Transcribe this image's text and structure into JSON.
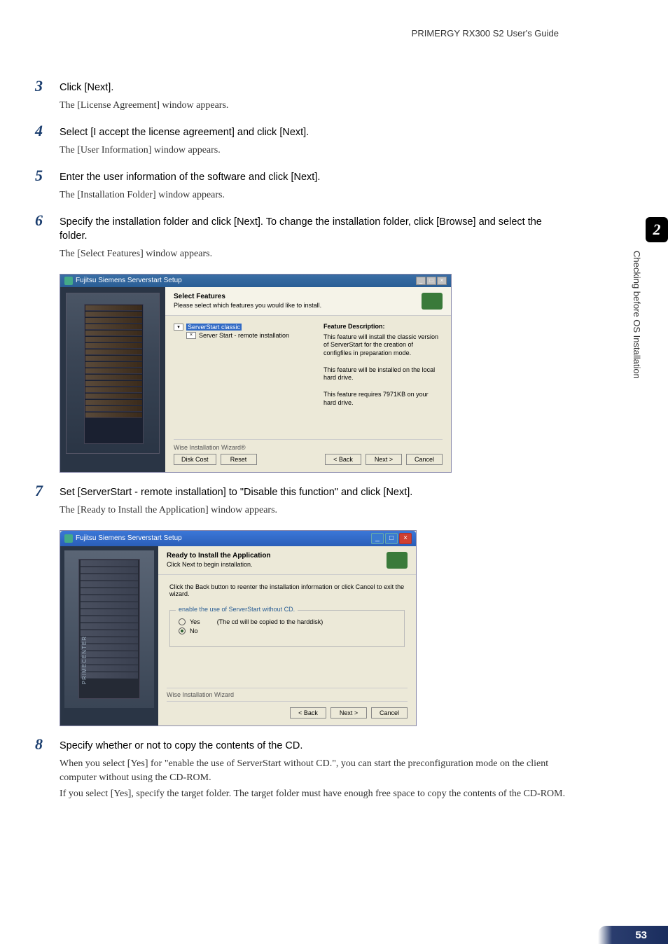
{
  "header": "PRIMERGY RX300 S2 User's Guide",
  "sideTab": {
    "chapter": "2",
    "label": "Checking before OS Installation"
  },
  "pageNumber": "53",
  "steps": {
    "s3": {
      "num": "3",
      "title": "Click [Next].",
      "desc": "The [License Agreement] window appears."
    },
    "s4": {
      "num": "4",
      "title": "Select [I accept the license agreement] and click [Next].",
      "desc": "The [User Information] window appears."
    },
    "s5": {
      "num": "5",
      "title": "Enter the user information of the software and click [Next].",
      "desc": "The [Installation Folder] window appears."
    },
    "s6": {
      "num": "6",
      "title": "Specify the installation folder and click [Next]. To change the installation folder, click [Browse] and select the folder.",
      "desc": "The [Select Features] window appears."
    },
    "s7": {
      "num": "7",
      "title": "Set [ServerStart - remote installation] to \"Disable this function\" and click [Next].",
      "desc": "The [Ready to Install the Application] window appears."
    },
    "s8": {
      "num": "8",
      "title": "Specify whether or not to copy the contents of the CD.",
      "desc1": "When you select [Yes] for \"enable the use of ServerStart without CD.\", you can start the preconfiguration mode on the client computer without using the CD-ROM.",
      "desc2": "If you select [Yes], specify the target folder. The target folder must have enough free space to copy the contents of the CD-ROM."
    }
  },
  "dialog1": {
    "title": "Fujitsu Siemens Serverstart Setup",
    "headerTitle": "Select Features",
    "headerSub": "Please select which features you would like to install.",
    "tree": {
      "item1": "ServerStart classic",
      "item2": "Server Start - remote installation",
      "x": "×",
      "dd": "▾"
    },
    "desc": {
      "title": "Feature Description:",
      "text1": "This feature will install the classic version of ServerStart for the creation of configfiles in preparation mode.",
      "text2": "This feature will be installed on the local hard drive.",
      "text3": "This feature requires 7971KB on your hard drive."
    },
    "wise": "Wise Installation Wizard®",
    "buttons": {
      "disk": "Disk Cost",
      "reset": "Reset",
      "back": "< Back",
      "next": "Next >",
      "cancel": "Cancel"
    }
  },
  "dialog2": {
    "title": "Fujitsu Siemens Serverstart Setup",
    "headerTitle": "Ready to Install the Application",
    "headerSub": "Click Next to begin installation.",
    "contentText": "Click the Back button to reenter the installation information or click Cancel to exit the wizard.",
    "groupTitle": "enable the use of ServerStart without CD.",
    "radioYes": "Yes",
    "radioNote": "(The cd will be copied to the harddisk)",
    "radioNo": "No",
    "wise": "Wise Installation Wizard",
    "buttons": {
      "back": "< Back",
      "next": "Next >",
      "cancel": "Cancel"
    },
    "rackLabel": "PRIMECENTER"
  }
}
